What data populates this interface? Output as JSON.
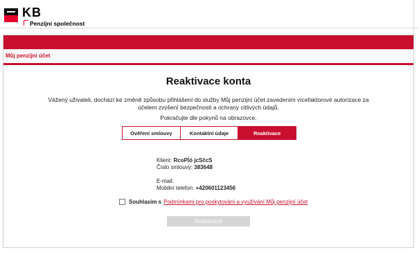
{
  "brand": {
    "logo_text": "KB",
    "subtitle": "Penzijní společnost",
    "colors": {
      "primary_red": "#c8102e",
      "logo_black": "#000000"
    }
  },
  "breadcrumb": {
    "label": "Můj penzijní účet"
  },
  "page": {
    "title": "Reaktivace konta",
    "intro": "Vážený uživateli, dochází ke změně způsobu přihlášení do služby Můj penzijní účet zavedením vícefaktorové autorizace za účelem zvýšení bezpečnosti a ochrany citlivých údajů.",
    "continue_text": "Pokračujte dle pokynů na obrazovce."
  },
  "steps": [
    {
      "label": "Ověření smlouvy",
      "active": false
    },
    {
      "label": "Kontaktní údaje",
      "active": false
    },
    {
      "label": "Reaktivace",
      "active": true
    }
  ],
  "client": {
    "client_label": "Klient:",
    "client_value": "RcoPĺó jcSčcS",
    "contract_label": "Číslo smlouvy:",
    "contract_value": "383648",
    "email_label": "E-mail:",
    "email_value": "",
    "phone_label": "Mobilní telefon:",
    "phone_value": "+420601123456"
  },
  "consent": {
    "prefix": "Souhlasím s",
    "link": "Podmínkami pro poskytování a využívání Můj penzijní účet",
    "checked": false
  },
  "submit": {
    "label": "Reaktivace",
    "disabled": true
  }
}
